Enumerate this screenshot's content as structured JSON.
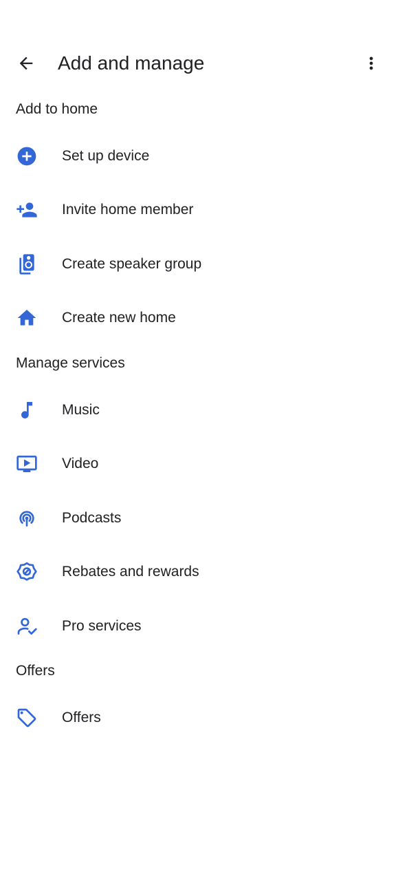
{
  "header": {
    "title": "Add and manage",
    "back_icon": "arrow-back-icon",
    "more_icon": "more-vert-icon"
  },
  "accent_color": "#3367d6",
  "sections": [
    {
      "title": "Add to home",
      "items": [
        {
          "label": "Set up device",
          "icon": "add-circle-icon"
        },
        {
          "label": "Invite home member",
          "icon": "person-add-icon"
        },
        {
          "label": "Create speaker group",
          "icon": "speaker-group-icon"
        },
        {
          "label": "Create new home",
          "icon": "home-icon"
        }
      ]
    },
    {
      "title": "Manage services",
      "items": [
        {
          "label": "Music",
          "icon": "music-note-icon"
        },
        {
          "label": "Video",
          "icon": "video-icon"
        },
        {
          "label": "Podcasts",
          "icon": "podcasts-icon"
        },
        {
          "label": "Rebates and rewards",
          "icon": "rewards-icon"
        },
        {
          "label": "Pro services",
          "icon": "pro-services-icon"
        }
      ]
    },
    {
      "title": "Offers",
      "items": [
        {
          "label": "Offers",
          "icon": "tag-icon"
        }
      ]
    }
  ]
}
